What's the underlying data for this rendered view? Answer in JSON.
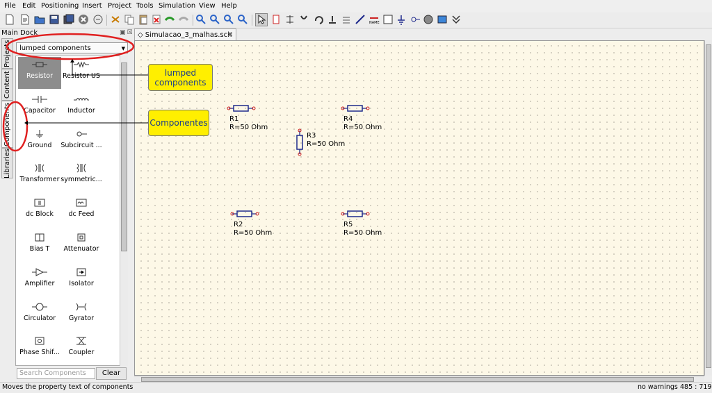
{
  "menu": [
    "File",
    "Edit",
    "Positioning",
    "Insert",
    "Project",
    "Tools",
    "Simulation",
    "View",
    "Help"
  ],
  "dock": {
    "title": "Main Dock",
    "tabs": [
      "Projects",
      "Content",
      "Components",
      "Libraries"
    ],
    "selected_tab": "Components",
    "category": "lumped components",
    "search_placeholder": "Search Components",
    "clear_label": "Clear"
  },
  "components": [
    {
      "label": "Resistor",
      "icon": "resistor-icon",
      "selected": true
    },
    {
      "label": "Resistor US",
      "icon": "resistor-us-icon"
    },
    {
      "label": "Capacitor",
      "icon": "capacitor-icon"
    },
    {
      "label": "Inductor",
      "icon": "inductor-icon"
    },
    {
      "label": "Ground",
      "icon": "ground-icon"
    },
    {
      "label": "Subcircuit ...",
      "icon": "subcircuit-port-icon"
    },
    {
      "label": "Transformer",
      "icon": "transformer-icon"
    },
    {
      "label": "symmetric...",
      "icon": "symmetric-transformer-icon"
    },
    {
      "label": "dc Block",
      "icon": "dc-block-icon"
    },
    {
      "label": "dc Feed",
      "icon": "dc-feed-icon"
    },
    {
      "label": "Bias T",
      "icon": "bias-t-icon"
    },
    {
      "label": "Attenuator",
      "icon": "attenuator-icon"
    },
    {
      "label": "Amplifier",
      "icon": "amplifier-icon"
    },
    {
      "label": "Isolator",
      "icon": "isolator-icon"
    },
    {
      "label": "Circulator",
      "icon": "circulator-icon"
    },
    {
      "label": "Gyrator",
      "icon": "gyrator-icon"
    },
    {
      "label": "Phase Shif...",
      "icon": "phase-shifter-icon"
    },
    {
      "label": "Coupler",
      "icon": "coupler-icon"
    }
  ],
  "document_tab": "Simulacao_3_malhas.sch",
  "schematic": [
    {
      "name": "R1",
      "value": "R=50 Ohm",
      "orientation": "horizontal"
    },
    {
      "name": "R4",
      "value": "R=50 Ohm",
      "orientation": "horizontal"
    },
    {
      "name": "R3",
      "value": "R=50 Ohm",
      "orientation": "vertical"
    },
    {
      "name": "R2",
      "value": "R=50 Ohm",
      "orientation": "horizontal"
    },
    {
      "name": "R5",
      "value": "R=50 Ohm",
      "orientation": "horizontal"
    }
  ],
  "annotations": [
    {
      "text": "lumped components"
    },
    {
      "text": "Componentes"
    }
  ],
  "status": {
    "message": "Moves the property text of components",
    "warnings": "no warnings",
    "coords": "485 : 719"
  },
  "colors": {
    "canvas_bg": "#fdf8e7",
    "wire_blue": "#1f2a8c",
    "pin_red": "#cc2020",
    "annotation_fill": "#ffef00",
    "annotation_text": "#1a3b8c",
    "highlight_ellipse": "#e02020"
  }
}
